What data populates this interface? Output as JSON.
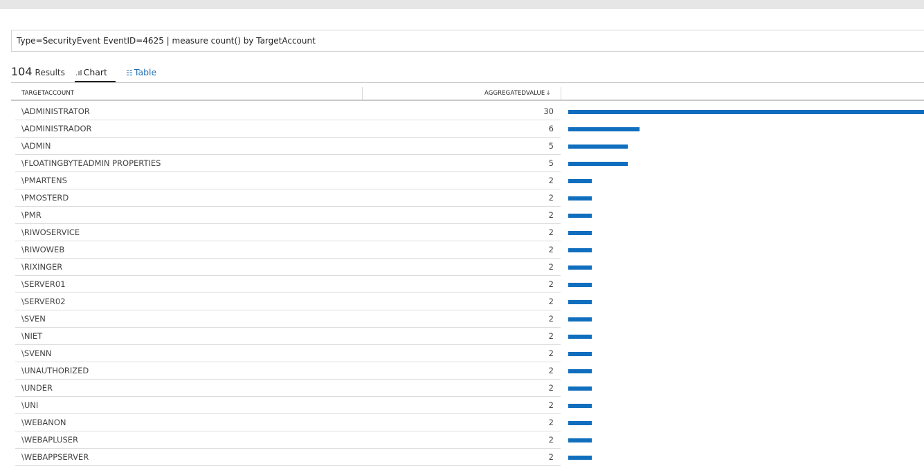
{
  "query": {
    "text": "Type=SecurityEvent EventID=4625 | measure count() by TargetAccount"
  },
  "results": {
    "count": "104",
    "label": "Results",
    "tabs": {
      "chart": "Chart",
      "table": "Table"
    }
  },
  "table": {
    "columns": {
      "account": "TARGETACCOUNT",
      "value": "AGGREGATEDVALUE"
    },
    "rows": [
      {
        "account": "\\ADMINISTRATOR",
        "value": "30"
      },
      {
        "account": "\\ADMINISTRADOR",
        "value": "6"
      },
      {
        "account": "\\ADMIN",
        "value": "5"
      },
      {
        "account": "\\FLOATINGBYTEADMIN PROPERTIES",
        "value": "5"
      },
      {
        "account": "\\PMARTENS",
        "value": "2"
      },
      {
        "account": "\\PMOSTERD",
        "value": "2"
      },
      {
        "account": "\\PMR",
        "value": "2"
      },
      {
        "account": "\\RIWOSERVICE",
        "value": "2"
      },
      {
        "account": "\\RIWOWEB",
        "value": "2"
      },
      {
        "account": "\\RIXINGER",
        "value": "2"
      },
      {
        "account": "\\SERVER01",
        "value": "2"
      },
      {
        "account": "\\SERVER02",
        "value": "2"
      },
      {
        "account": "\\SVEN",
        "value": "2"
      },
      {
        "account": "\\NIET",
        "value": "2"
      },
      {
        "account": "\\SVENN",
        "value": "2"
      },
      {
        "account": "\\UNAUTHORIZED",
        "value": "2"
      },
      {
        "account": "\\UNDER",
        "value": "2"
      },
      {
        "account": "\\UNI",
        "value": "2"
      },
      {
        "account": "\\WEBANON",
        "value": "2"
      },
      {
        "account": "\\WEBAPLUSER",
        "value": "2"
      },
      {
        "account": "\\WEBAPPSERVER",
        "value": "2"
      }
    ]
  },
  "colors": {
    "bar": "#106ebe",
    "link": "#1f6fb5"
  },
  "icons": {
    "chart_tab": "bar-chart-icon",
    "table_tab": "table-list-icon",
    "sort": "sort-down-arrow-icon"
  }
}
